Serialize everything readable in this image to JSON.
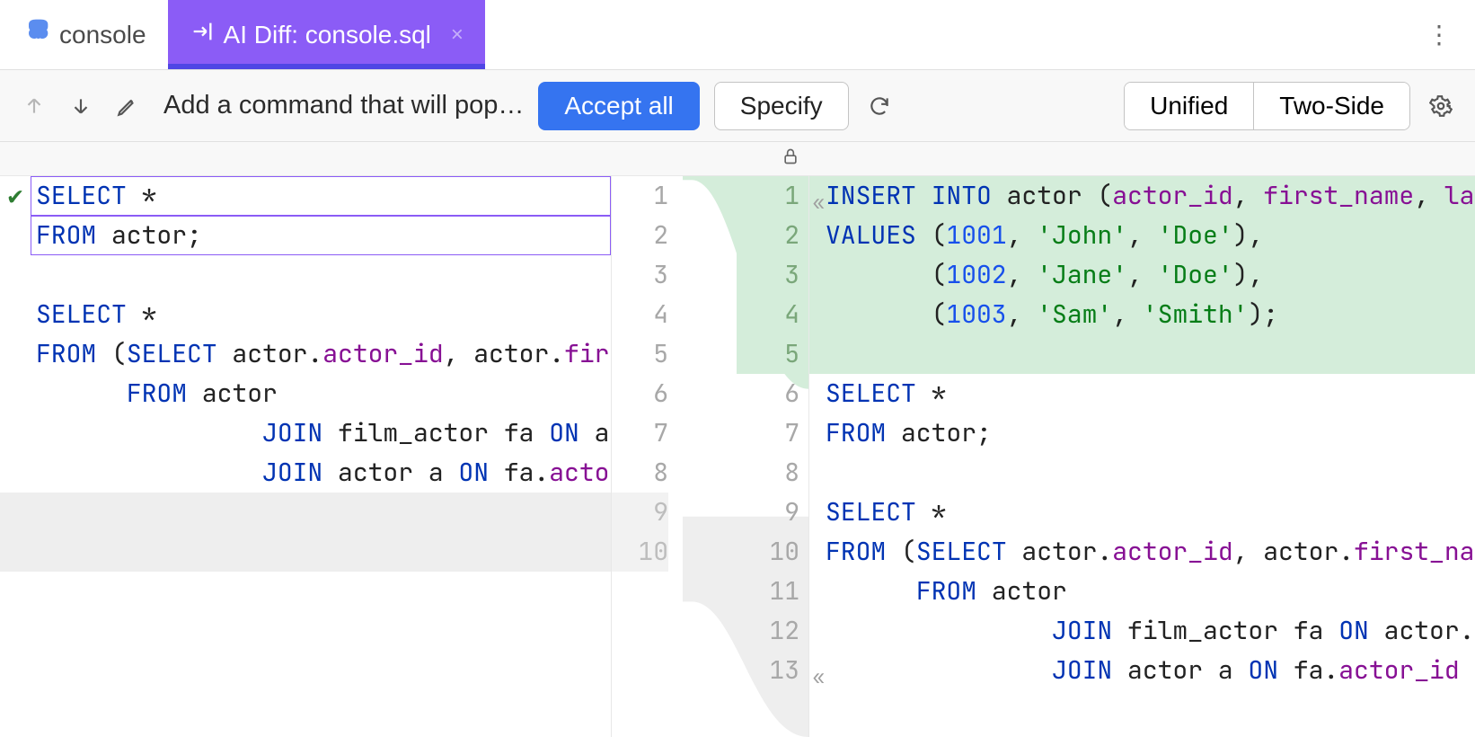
{
  "tabs": {
    "console": "console",
    "ai_diff": "AI Diff: console.sql"
  },
  "toolbar": {
    "command_text": "Add a command that will pop…",
    "accept_all": "Accept all",
    "specify": "Specify",
    "view_unified": "Unified",
    "view_two_side": "Two-Side"
  },
  "left_code": [
    {
      "n": 1,
      "tokens": [
        {
          "t": "SELECT",
          "c": "kw"
        },
        {
          "t": " *",
          "c": "punct"
        }
      ],
      "boxed": true,
      "check": true
    },
    {
      "n": 2,
      "tokens": [
        {
          "t": "FROM",
          "c": "kw"
        },
        {
          "t": " actor",
          "c": "punct"
        },
        {
          "t": ";",
          "c": "punct"
        }
      ],
      "boxed": true
    },
    {
      "n": 3,
      "tokens": []
    },
    {
      "n": 4,
      "tokens": [
        {
          "t": "SELECT",
          "c": "kw"
        },
        {
          "t": " *",
          "c": "punct"
        }
      ]
    },
    {
      "n": 5,
      "tokens": [
        {
          "t": "FROM",
          "c": "kw"
        },
        {
          "t": " (",
          "c": "punct"
        },
        {
          "t": "SELECT",
          "c": "kw"
        },
        {
          "t": " actor.",
          "c": "punct"
        },
        {
          "t": "actor_id",
          "c": "ident"
        },
        {
          "t": ", actor.",
          "c": "punct"
        },
        {
          "t": "first_",
          "c": "ident"
        }
      ]
    },
    {
      "n": 6,
      "tokens": [
        {
          "t": "      ",
          "c": "punct"
        },
        {
          "t": "FROM",
          "c": "kw"
        },
        {
          "t": " actor",
          "c": "punct"
        }
      ]
    },
    {
      "n": 7,
      "tokens": [
        {
          "t": "               ",
          "c": "punct"
        },
        {
          "t": "JOIN",
          "c": "kw"
        },
        {
          "t": " film_actor fa ",
          "c": "punct"
        },
        {
          "t": "ON",
          "c": "kw"
        },
        {
          "t": " actc",
          "c": "punct"
        }
      ]
    },
    {
      "n": 8,
      "tokens": [
        {
          "t": "               ",
          "c": "punct"
        },
        {
          "t": "JOIN",
          "c": "kw"
        },
        {
          "t": " actor a ",
          "c": "punct"
        },
        {
          "t": "ON",
          "c": "kw"
        },
        {
          "t": " fa.",
          "c": "punct"
        },
        {
          "t": "actor_i",
          "c": "ident"
        }
      ]
    },
    {
      "n": 9,
      "tokens": [],
      "grey": true
    },
    {
      "n": 10,
      "tokens": [],
      "grey": true
    }
  ],
  "right_code": [
    {
      "n": 1,
      "green": true,
      "collapse": true,
      "tokens": [
        {
          "t": "INSERT INTO",
          "c": "kw"
        },
        {
          "t": " actor (",
          "c": "punct"
        },
        {
          "t": "actor_id",
          "c": "ident"
        },
        {
          "t": ", ",
          "c": "punct"
        },
        {
          "t": "first_name",
          "c": "ident"
        },
        {
          "t": ", ",
          "c": "punct"
        },
        {
          "t": "la",
          "c": "ident"
        }
      ]
    },
    {
      "n": 2,
      "green": true,
      "tokens": [
        {
          "t": "VALUES",
          "c": "kw"
        },
        {
          "t": " (",
          "c": "punct"
        },
        {
          "t": "1001",
          "c": "num"
        },
        {
          "t": ", ",
          "c": "punct"
        },
        {
          "t": "'John'",
          "c": "str"
        },
        {
          "t": ", ",
          "c": "punct"
        },
        {
          "t": "'Doe'",
          "c": "str"
        },
        {
          "t": "),",
          "c": "punct"
        }
      ]
    },
    {
      "n": 3,
      "green": true,
      "tokens": [
        {
          "t": "       (",
          "c": "punct"
        },
        {
          "t": "1002",
          "c": "num"
        },
        {
          "t": ", ",
          "c": "punct"
        },
        {
          "t": "'Jane'",
          "c": "str"
        },
        {
          "t": ", ",
          "c": "punct"
        },
        {
          "t": "'Doe'",
          "c": "str"
        },
        {
          "t": "),",
          "c": "punct"
        }
      ]
    },
    {
      "n": 4,
      "green": true,
      "tokens": [
        {
          "t": "       (",
          "c": "punct"
        },
        {
          "t": "1003",
          "c": "num"
        },
        {
          "t": ", ",
          "c": "punct"
        },
        {
          "t": "'Sam'",
          "c": "str"
        },
        {
          "t": ", ",
          "c": "punct"
        },
        {
          "t": "'Smith'",
          "c": "str"
        },
        {
          "t": ");",
          "c": "punct"
        }
      ]
    },
    {
      "n": 5,
      "green": true,
      "tokens": []
    },
    {
      "n": 6,
      "tokens": [
        {
          "t": "SELECT",
          "c": "kw"
        },
        {
          "t": " *",
          "c": "punct"
        }
      ]
    },
    {
      "n": 7,
      "tokens": [
        {
          "t": "FROM",
          "c": "kw"
        },
        {
          "t": " actor;",
          "c": "punct"
        }
      ]
    },
    {
      "n": 8,
      "tokens": []
    },
    {
      "n": 9,
      "tokens": [
        {
          "t": "SELECT",
          "c": "kw"
        },
        {
          "t": " *",
          "c": "punct"
        }
      ]
    },
    {
      "n": 10,
      "tokens": [
        {
          "t": "FROM",
          "c": "kw"
        },
        {
          "t": " (",
          "c": "punct"
        },
        {
          "t": "SELECT",
          "c": "kw"
        },
        {
          "t": " actor.",
          "c": "punct"
        },
        {
          "t": "actor_id",
          "c": "ident"
        },
        {
          "t": ", actor.",
          "c": "punct"
        },
        {
          "t": "first_na",
          "c": "ident"
        }
      ]
    },
    {
      "n": 11,
      "tokens": [
        {
          "t": "      ",
          "c": "punct"
        },
        {
          "t": "FROM",
          "c": "kw"
        },
        {
          "t": " actor",
          "c": "punct"
        }
      ]
    },
    {
      "n": 12,
      "tokens": [
        {
          "t": "               ",
          "c": "punct"
        },
        {
          "t": "JOIN",
          "c": "kw"
        },
        {
          "t": " film_actor fa ",
          "c": "punct"
        },
        {
          "t": "ON",
          "c": "kw"
        },
        {
          "t": " actor.",
          "c": "punct"
        }
      ]
    },
    {
      "n": 13,
      "collapse": true,
      "tokens": [
        {
          "t": "               ",
          "c": "punct"
        },
        {
          "t": "JOIN",
          "c": "kw"
        },
        {
          "t": " actor a ",
          "c": "punct"
        },
        {
          "t": "ON",
          "c": "kw"
        },
        {
          "t": " fa.",
          "c": "punct"
        },
        {
          "t": "actor_id",
          "c": "ident"
        }
      ]
    }
  ]
}
